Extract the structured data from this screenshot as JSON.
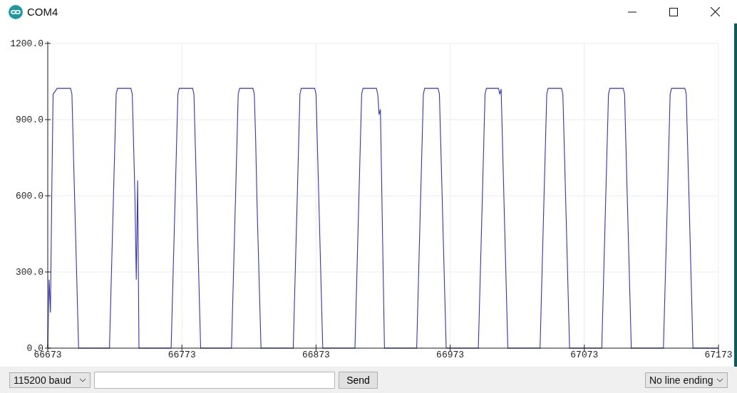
{
  "window": {
    "title": "COM4"
  },
  "plot": {
    "chart_data": {
      "type": "line",
      "xlim": [
        66673,
        67173
      ],
      "ylim": [
        0,
        1200
      ],
      "grid": true,
      "xticks": [
        66673,
        66773,
        66873,
        66973,
        67073,
        67173
      ],
      "yticks": [
        {
          "value": 0,
          "label": "0.0"
        },
        {
          "value": 300,
          "label": "300.0"
        },
        {
          "value": 600,
          "label": "600.0"
        },
        {
          "value": 900,
          "label": "900.0"
        },
        {
          "value": 1200,
          "label": "1200.0"
        }
      ],
      "x": [
        66673,
        66674,
        66675,
        66676,
        66677,
        66680,
        66690,
        66691,
        66693,
        66696,
        66719,
        66722,
        66724,
        66725,
        66735,
        66736,
        66738,
        66739,
        66740,
        66741,
        66765,
        66768,
        66770,
        66771,
        66781,
        66782,
        66784,
        66787,
        66810,
        66813,
        66815,
        66816,
        66826,
        66827,
        66828,
        66829,
        66832,
        66856,
        66859,
        66861,
        66862,
        66872,
        66873,
        66875,
        66878,
        66902,
        66905,
        66907,
        66908,
        66918,
        66919,
        66920,
        66921,
        66924,
        66948,
        66951,
        66953,
        66954,
        66964,
        66965,
        66967,
        66970,
        66994,
        66997,
        66999,
        67000,
        67009,
        67010,
        67011,
        67013,
        67016,
        67040,
        67043,
        67045,
        67046,
        67056,
        67057,
        67059,
        67062,
        67086,
        67089,
        67091,
        67092,
        67102,
        67103,
        67105,
        67108,
        67132,
        67135,
        67137,
        67138,
        67148,
        67149,
        67151,
        67154,
        67173
      ],
      "series": [
        {
          "color": "#3333bb",
          "values": [
            0,
            270,
            140,
            600,
            1000,
            1023,
            1023,
            1000,
            600,
            0,
            0,
            600,
            1000,
            1023,
            1023,
            1000,
            600,
            270,
            660,
            0,
            0,
            600,
            1000,
            1023,
            1023,
            1000,
            600,
            0,
            0,
            600,
            1000,
            1023,
            1023,
            1000,
            820,
            570,
            0,
            0,
            600,
            1000,
            1023,
            1023,
            1000,
            600,
            0,
            0,
            600,
            1000,
            1023,
            1023,
            1000,
            920,
            940,
            0,
            0,
            600,
            1000,
            1023,
            1023,
            1000,
            600,
            0,
            0,
            600,
            1000,
            1023,
            1023,
            1000,
            1020,
            600,
            0,
            0,
            600,
            1000,
            1023,
            1023,
            1000,
            600,
            0,
            0,
            600,
            1000,
            1023,
            1023,
            1000,
            600,
            0,
            0,
            600,
            1000,
            1023,
            1023,
            1000,
            600,
            0,
            0
          ]
        }
      ]
    }
  },
  "controls": {
    "baud_rate": "115200 baud",
    "send_button": "Send",
    "line_ending": "No line ending"
  }
}
